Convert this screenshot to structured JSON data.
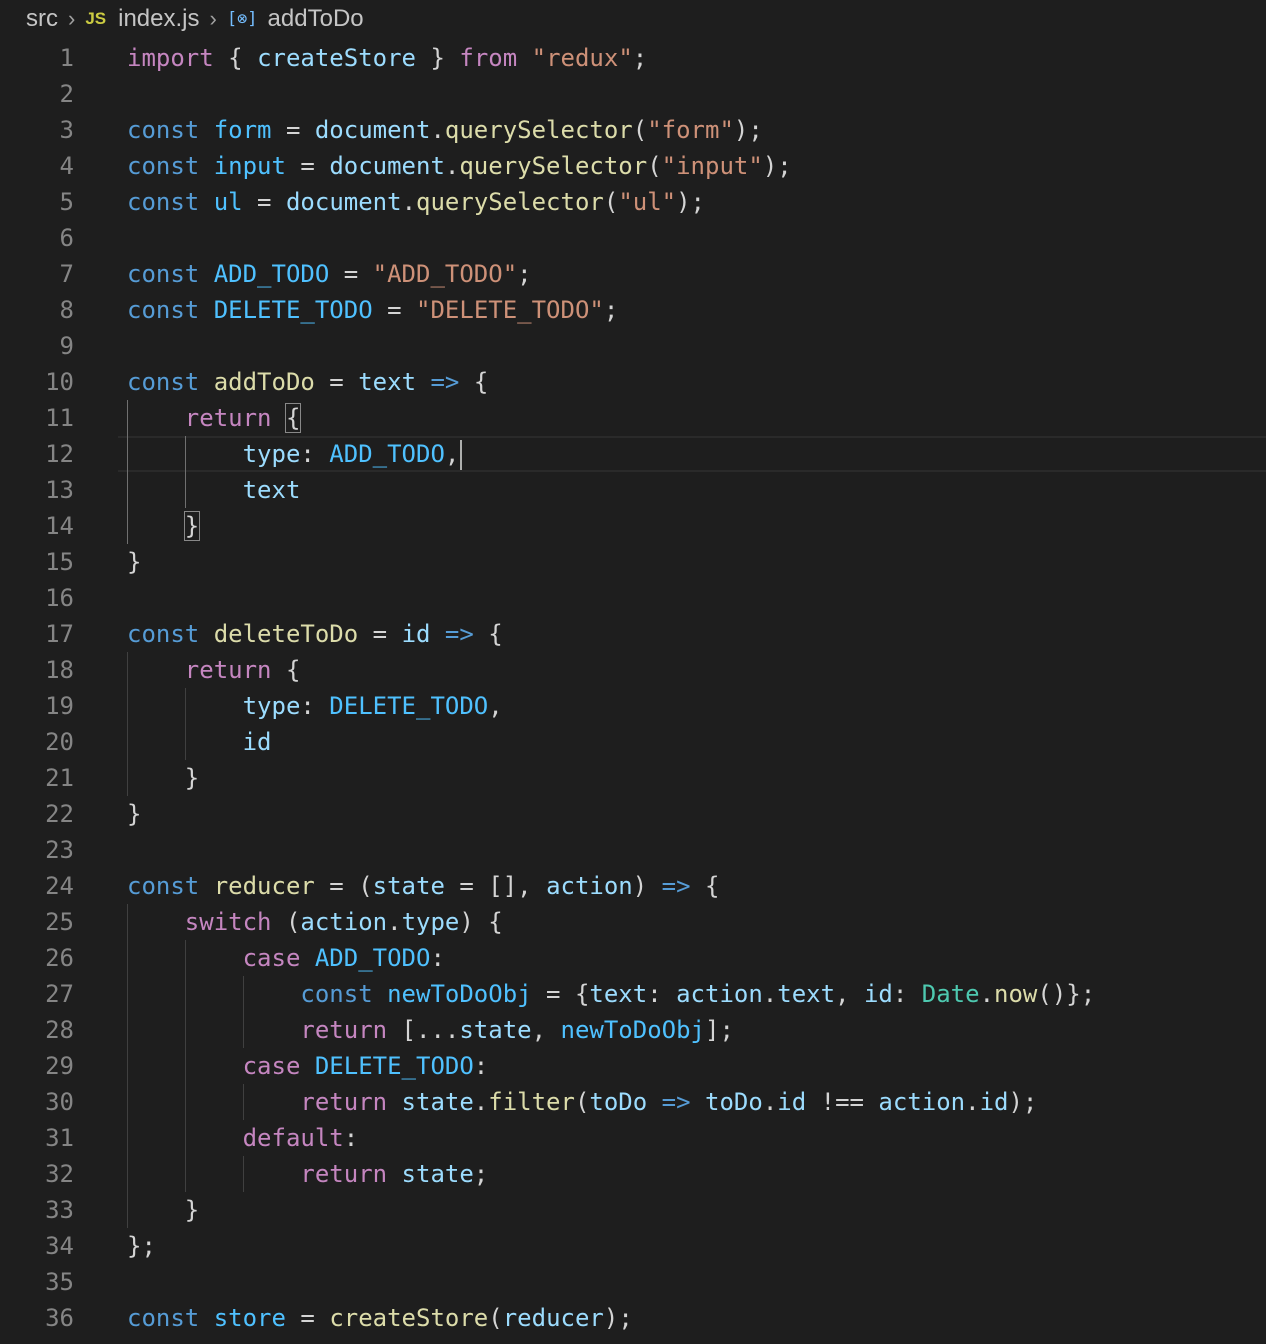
{
  "breadcrumb": {
    "folder": "src",
    "file_icon": "JS",
    "file": "index.js",
    "symbol_icon": "[⊗]",
    "symbol": "addToDo"
  },
  "editor": {
    "cursor_line": 12,
    "lines": [
      {
        "n": "1",
        "tokens": [
          [
            "kw",
            "import"
          ],
          [
            "p",
            " { "
          ],
          [
            "v",
            "createStore"
          ],
          [
            "p",
            " } "
          ],
          [
            "kw",
            "from"
          ],
          [
            "p",
            " "
          ],
          [
            "s",
            "\"redux\""
          ],
          [
            "p",
            ";"
          ]
        ]
      },
      {
        "n": "2",
        "tokens": []
      },
      {
        "n": "3",
        "tokens": [
          [
            "st",
            "const"
          ],
          [
            "p",
            " "
          ],
          [
            "c",
            "form"
          ],
          [
            "p",
            " = "
          ],
          [
            "v",
            "document"
          ],
          [
            "p",
            "."
          ],
          [
            "f",
            "querySelector"
          ],
          [
            "p",
            "("
          ],
          [
            "s",
            "\"form\""
          ],
          [
            "p",
            ");"
          ]
        ]
      },
      {
        "n": "4",
        "tokens": [
          [
            "st",
            "const"
          ],
          [
            "p",
            " "
          ],
          [
            "c",
            "input"
          ],
          [
            "p",
            " = "
          ],
          [
            "v",
            "document"
          ],
          [
            "p",
            "."
          ],
          [
            "f",
            "querySelector"
          ],
          [
            "p",
            "("
          ],
          [
            "s",
            "\"input\""
          ],
          [
            "p",
            ");"
          ]
        ]
      },
      {
        "n": "5",
        "tokens": [
          [
            "st",
            "const"
          ],
          [
            "p",
            " "
          ],
          [
            "c",
            "ul"
          ],
          [
            "p",
            " = "
          ],
          [
            "v",
            "document"
          ],
          [
            "p",
            "."
          ],
          [
            "f",
            "querySelector"
          ],
          [
            "p",
            "("
          ],
          [
            "s",
            "\"ul\""
          ],
          [
            "p",
            ");"
          ]
        ]
      },
      {
        "n": "6",
        "tokens": []
      },
      {
        "n": "7",
        "tokens": [
          [
            "st",
            "const"
          ],
          [
            "p",
            " "
          ],
          [
            "c",
            "ADD_TODO"
          ],
          [
            "p",
            " = "
          ],
          [
            "s",
            "\"ADD_TODO\""
          ],
          [
            "p",
            ";"
          ]
        ]
      },
      {
        "n": "8",
        "tokens": [
          [
            "st",
            "const"
          ],
          [
            "p",
            " "
          ],
          [
            "c",
            "DELETE_TODO"
          ],
          [
            "p",
            " = "
          ],
          [
            "s",
            "\"DELETE_TODO\""
          ],
          [
            "p",
            ";"
          ]
        ]
      },
      {
        "n": "9",
        "tokens": []
      },
      {
        "n": "10",
        "tokens": [
          [
            "st",
            "const"
          ],
          [
            "p",
            " "
          ],
          [
            "f",
            "addToDo"
          ],
          [
            "p",
            " = "
          ],
          [
            "v",
            "text"
          ],
          [
            "p",
            " "
          ],
          [
            "st",
            "=>"
          ],
          [
            "p",
            " {"
          ]
        ]
      },
      {
        "n": "11",
        "tokens": [
          [
            "p",
            "    "
          ],
          [
            "kw",
            "return"
          ],
          [
            "p",
            " "
          ],
          [
            "bm",
            "{"
          ]
        ]
      },
      {
        "n": "12",
        "tokens": [
          [
            "p",
            "        "
          ],
          [
            "v",
            "type"
          ],
          [
            "p",
            ": "
          ],
          [
            "c",
            "ADD_TODO"
          ],
          [
            "p",
            ","
          ]
        ]
      },
      {
        "n": "13",
        "tokens": [
          [
            "p",
            "        "
          ],
          [
            "v",
            "text"
          ]
        ]
      },
      {
        "n": "14",
        "tokens": [
          [
            "p",
            "    "
          ],
          [
            "bm",
            "}"
          ]
        ]
      },
      {
        "n": "15",
        "tokens": [
          [
            "p",
            "}"
          ]
        ]
      },
      {
        "n": "16",
        "tokens": []
      },
      {
        "n": "17",
        "tokens": [
          [
            "st",
            "const"
          ],
          [
            "p",
            " "
          ],
          [
            "f",
            "deleteToDo"
          ],
          [
            "p",
            " = "
          ],
          [
            "v",
            "id"
          ],
          [
            "p",
            " "
          ],
          [
            "st",
            "=>"
          ],
          [
            "p",
            " {"
          ]
        ]
      },
      {
        "n": "18",
        "tokens": [
          [
            "p",
            "    "
          ],
          [
            "kw",
            "return"
          ],
          [
            "p",
            " {"
          ]
        ]
      },
      {
        "n": "19",
        "tokens": [
          [
            "p",
            "        "
          ],
          [
            "v",
            "type"
          ],
          [
            "p",
            ": "
          ],
          [
            "c",
            "DELETE_TODO"
          ],
          [
            "p",
            ","
          ]
        ]
      },
      {
        "n": "20",
        "tokens": [
          [
            "p",
            "        "
          ],
          [
            "v",
            "id"
          ]
        ]
      },
      {
        "n": "21",
        "tokens": [
          [
            "p",
            "    }"
          ]
        ]
      },
      {
        "n": "22",
        "tokens": [
          [
            "p",
            "}"
          ]
        ]
      },
      {
        "n": "23",
        "tokens": []
      },
      {
        "n": "24",
        "tokens": [
          [
            "st",
            "const"
          ],
          [
            "p",
            " "
          ],
          [
            "f",
            "reducer"
          ],
          [
            "p",
            " = ("
          ],
          [
            "v",
            "state"
          ],
          [
            "p",
            " = [], "
          ],
          [
            "v",
            "action"
          ],
          [
            "p",
            ") "
          ],
          [
            "st",
            "=>"
          ],
          [
            "p",
            " {"
          ]
        ]
      },
      {
        "n": "25",
        "tokens": [
          [
            "p",
            "    "
          ],
          [
            "kw",
            "switch"
          ],
          [
            "p",
            " ("
          ],
          [
            "v",
            "action"
          ],
          [
            "p",
            "."
          ],
          [
            "v",
            "type"
          ],
          [
            "p",
            ") {"
          ]
        ]
      },
      {
        "n": "26",
        "tokens": [
          [
            "p",
            "        "
          ],
          [
            "kw",
            "case"
          ],
          [
            "p",
            " "
          ],
          [
            "c",
            "ADD_TODO"
          ],
          [
            "p",
            ":"
          ]
        ]
      },
      {
        "n": "27",
        "tokens": [
          [
            "p",
            "            "
          ],
          [
            "st",
            "const"
          ],
          [
            "p",
            " "
          ],
          [
            "c",
            "newToDoObj"
          ],
          [
            "p",
            " = {"
          ],
          [
            "v",
            "text"
          ],
          [
            "p",
            ": "
          ],
          [
            "v",
            "action"
          ],
          [
            "p",
            "."
          ],
          [
            "v",
            "text"
          ],
          [
            "p",
            ", "
          ],
          [
            "v",
            "id"
          ],
          [
            "p",
            ": "
          ],
          [
            "cls",
            "Date"
          ],
          [
            "p",
            "."
          ],
          [
            "f",
            "now"
          ],
          [
            "p",
            "()};"
          ]
        ]
      },
      {
        "n": "28",
        "tokens": [
          [
            "p",
            "            "
          ],
          [
            "kw",
            "return"
          ],
          [
            "p",
            " [..."
          ],
          [
            "v",
            "state"
          ],
          [
            "p",
            ", "
          ],
          [
            "c",
            "newToDoObj"
          ],
          [
            "p",
            "];"
          ]
        ]
      },
      {
        "n": "29",
        "tokens": [
          [
            "p",
            "        "
          ],
          [
            "kw",
            "case"
          ],
          [
            "p",
            " "
          ],
          [
            "c",
            "DELETE_TODO"
          ],
          [
            "p",
            ":"
          ]
        ]
      },
      {
        "n": "30",
        "tokens": [
          [
            "p",
            "            "
          ],
          [
            "kw",
            "return"
          ],
          [
            "p",
            " "
          ],
          [
            "v",
            "state"
          ],
          [
            "p",
            "."
          ],
          [
            "f",
            "filter"
          ],
          [
            "p",
            "("
          ],
          [
            "v",
            "toDo"
          ],
          [
            "p",
            " "
          ],
          [
            "st",
            "=>"
          ],
          [
            "p",
            " "
          ],
          [
            "v",
            "toDo"
          ],
          [
            "p",
            "."
          ],
          [
            "v",
            "id"
          ],
          [
            "p",
            " !== "
          ],
          [
            "v",
            "action"
          ],
          [
            "p",
            "."
          ],
          [
            "v",
            "id"
          ],
          [
            "p",
            ");"
          ]
        ]
      },
      {
        "n": "31",
        "tokens": [
          [
            "p",
            "        "
          ],
          [
            "kw",
            "default"
          ],
          [
            "p",
            ":"
          ]
        ]
      },
      {
        "n": "32",
        "tokens": [
          [
            "p",
            "            "
          ],
          [
            "kw",
            "return"
          ],
          [
            "p",
            " "
          ],
          [
            "v",
            "state"
          ],
          [
            "p",
            ";"
          ]
        ]
      },
      {
        "n": "33",
        "tokens": [
          [
            "p",
            "    }"
          ]
        ]
      },
      {
        "n": "34",
        "tokens": [
          [
            "p",
            "};"
          ]
        ]
      },
      {
        "n": "35",
        "tokens": []
      },
      {
        "n": "36",
        "tokens": [
          [
            "st",
            "const"
          ],
          [
            "p",
            " "
          ],
          [
            "c",
            "store"
          ],
          [
            "p",
            " = "
          ],
          [
            "f",
            "createStore"
          ],
          [
            "p",
            "("
          ],
          [
            "v",
            "reducer"
          ],
          [
            "p",
            ");"
          ]
        ]
      }
    ]
  }
}
